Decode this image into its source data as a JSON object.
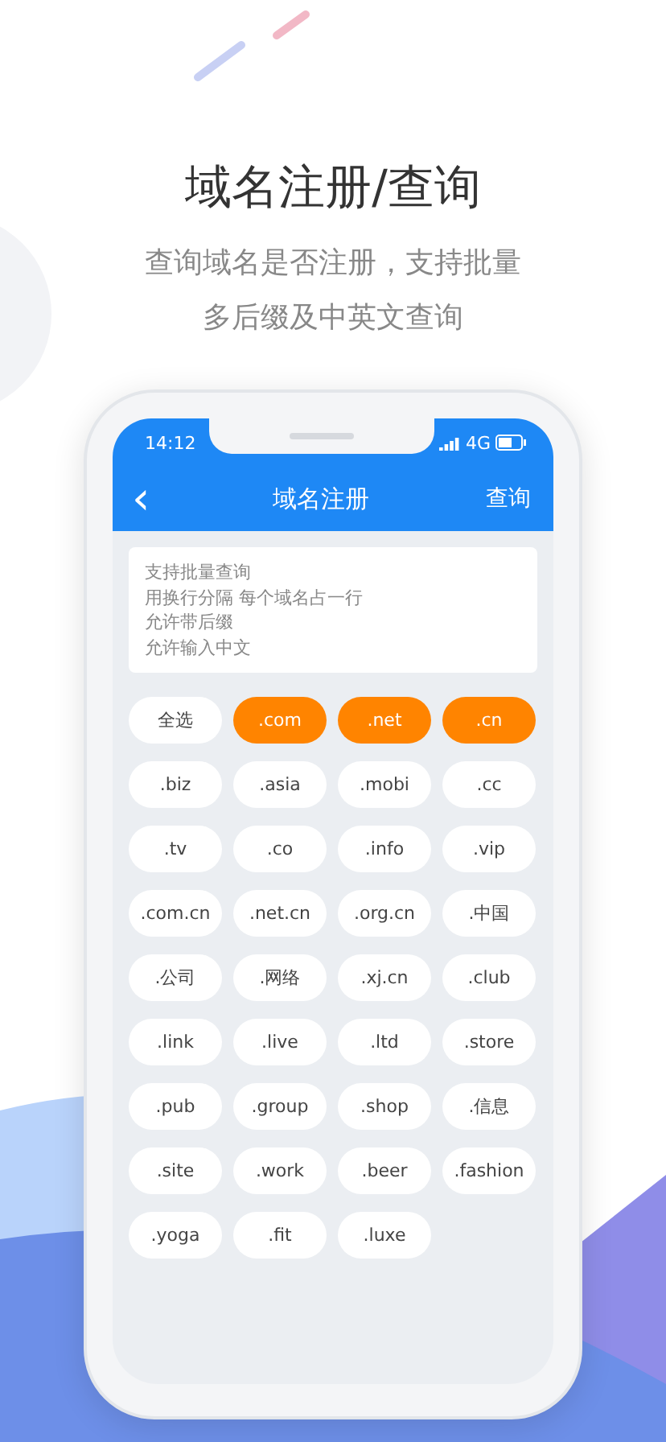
{
  "headline": "域名注册/查询",
  "subtitle": [
    "查询域名是否注册，支持批量",
    "多后缀及中英文查询"
  ],
  "status_bar": {
    "time": "14:12",
    "network": "4G"
  },
  "nav": {
    "back": "‹",
    "title": "域名注册",
    "action": "查询"
  },
  "query_field": {
    "placeholder": [
      "支持批量查询",
      "用换行分隔 每个域名占一行",
      "允许带后缀",
      "允许输入中文"
    ]
  },
  "suffixes": [
    {
      "label": "全选",
      "selected": false
    },
    {
      "label": ".com",
      "selected": true
    },
    {
      "label": ".net",
      "selected": true
    },
    {
      "label": ".cn",
      "selected": true
    },
    {
      "label": ".biz",
      "selected": false
    },
    {
      "label": ".asia",
      "selected": false
    },
    {
      "label": ".mobi",
      "selected": false
    },
    {
      "label": ".cc",
      "selected": false
    },
    {
      "label": ".tv",
      "selected": false
    },
    {
      "label": ".co",
      "selected": false
    },
    {
      "label": ".info",
      "selected": false
    },
    {
      "label": ".vip",
      "selected": false
    },
    {
      "label": ".com.cn",
      "selected": false
    },
    {
      "label": ".net.cn",
      "selected": false
    },
    {
      "label": ".org.cn",
      "selected": false
    },
    {
      "label": ".中国",
      "selected": false
    },
    {
      "label": ".公司",
      "selected": false
    },
    {
      "label": ".网络",
      "selected": false
    },
    {
      "label": ".xj.cn",
      "selected": false
    },
    {
      "label": ".club",
      "selected": false
    },
    {
      "label": ".link",
      "selected": false
    },
    {
      "label": ".live",
      "selected": false
    },
    {
      "label": ".ltd",
      "selected": false
    },
    {
      "label": ".store",
      "selected": false
    },
    {
      "label": ".pub",
      "selected": false
    },
    {
      "label": ".group",
      "selected": false
    },
    {
      "label": ".shop",
      "selected": false
    },
    {
      "label": ".信息",
      "selected": false
    },
    {
      "label": ".site",
      "selected": false
    },
    {
      "label": ".work",
      "selected": false
    },
    {
      "label": ".beer",
      "selected": false
    },
    {
      "label": ".fashion",
      "selected": false
    },
    {
      "label": ".yoga",
      "selected": false
    },
    {
      "label": ".fit",
      "selected": false
    },
    {
      "label": ".luxe",
      "selected": false
    }
  ]
}
